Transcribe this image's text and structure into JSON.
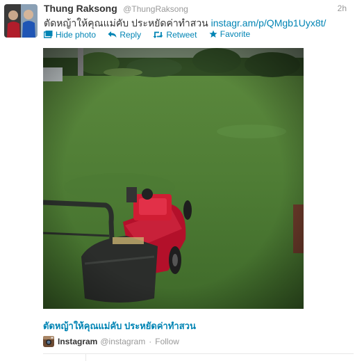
{
  "tweet": {
    "fullname": "Thung Raksong",
    "handle": "@ThungRaksong",
    "time": "2h",
    "text": "ตัดหญ้าให้คุณแม่คับ ประหยัดค่าทำสวน",
    "link": "instagr.am/p/QMgb1Uyx8t/"
  },
  "actions": {
    "hide_photo": "Hide photo",
    "reply": "Reply",
    "retweet": "Retweet",
    "favorite": "Favorite"
  },
  "card": {
    "title": "ตัดหญ้าให้คุณแม่คับ ประหยัดค่าทำสวน",
    "source_name": "Instagram",
    "source_handle": "@instagram",
    "separator": "·",
    "follow": "Follow"
  },
  "colors": {
    "link": "#0084b4",
    "muted": "#999999",
    "text": "#333333"
  }
}
